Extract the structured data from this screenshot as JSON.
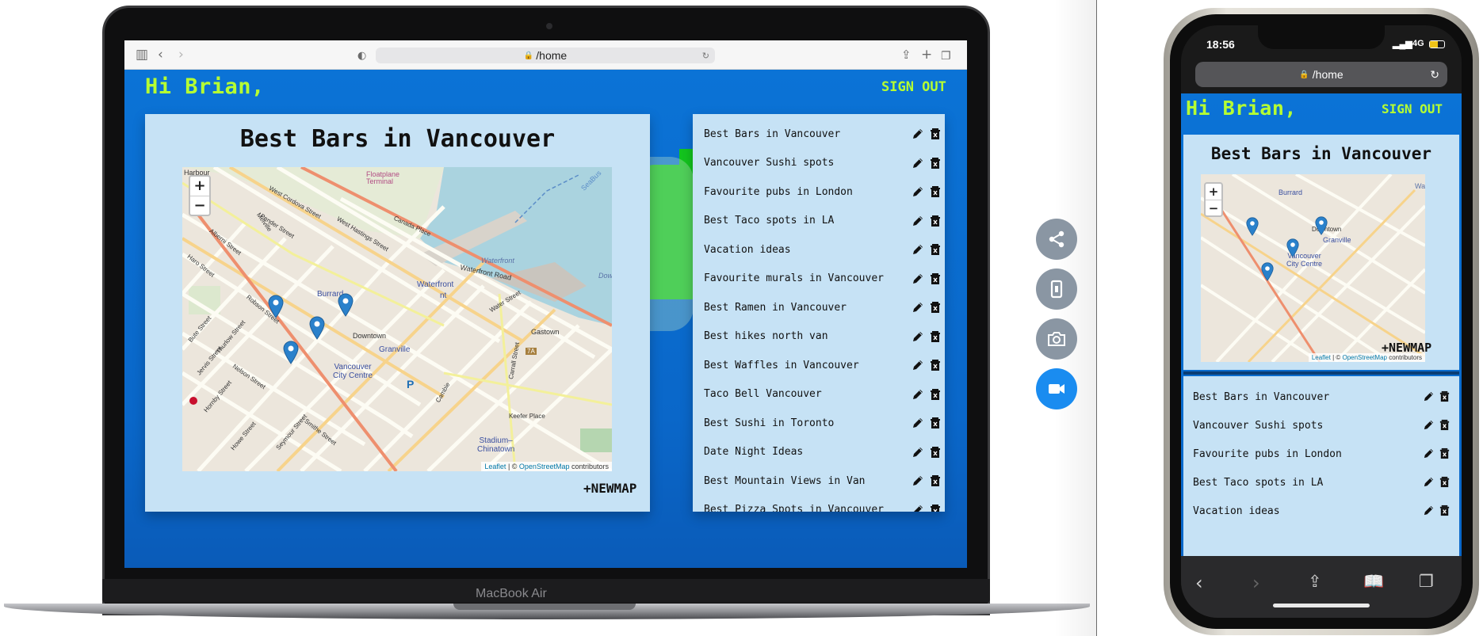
{
  "desktop": {
    "url": "/home",
    "greeting": "Hi Brian,",
    "sign_out": "SIGN OUT",
    "map_title": "Best Bars in Vancouver",
    "new_map": "+NEWMAP",
    "device_label": "MacBook Air",
    "attribution": {
      "leaflet": "Leaflet",
      "sep": " | © ",
      "osm": "OpenStreetMap",
      "contrib": " contributors"
    },
    "lists": [
      "Best Bars in Vancouver",
      "Vancouver Sushi spots",
      "Favourite pubs in London",
      "Best Taco spots in LA",
      "Vacation ideas",
      "Favourite murals in Vancouver",
      "Best Ramen in Vancouver",
      "Best hikes north van",
      "Best Waffles in Vancouver",
      "Taco Bell Vancouver",
      "Best Sushi in Toronto",
      "Date Night Ideas",
      "Best Mountain Views in Van",
      "Best Pizza Spots in Vancouver"
    ]
  },
  "map_labels": {
    "harbour": "Harbour",
    "floatplane": "Floatplane Terminal",
    "seabus": "SeaBus",
    "waterfront_a": "Waterfront",
    "waterfront_b": "Waterfront",
    "waterfront_road": "Waterfront Road",
    "waterfront_nt": "nt",
    "burrard": "Burrard",
    "downtown": "Downtown",
    "granville": "Granville",
    "vcc_line1": "Vancouver",
    "vcc_line2": "City Centre",
    "gastown": "Gastown",
    "stadium_line1": "Stadium–",
    "stadium_line2": "Chinatown",
    "pender": "Pender Street",
    "cordova": "West Cordova Street",
    "canada_place": "Canada Place",
    "hastings": "West Hastings Street",
    "robson": "Robson Street",
    "water_street": "Water Street",
    "seymour": "Seymour Street",
    "howe": "Howe Street",
    "hornby": "Hornby Street",
    "nelson": "Nelson Street",
    "smithe": "Smithe Street",
    "carrall": "Carrall Street",
    "keefer": "Keefer Place",
    "alberni": "Alberni Street",
    "haro": "Haro Street",
    "melville": "Melville",
    "thurlow": "Thurlow Street",
    "jervis": "Jervis Street",
    "bute": "Bute Street",
    "cambie": "Cambie",
    "seven_a": "7A",
    "dow": "Dow",
    "p": "P"
  },
  "phone": {
    "time": "18:56",
    "network": "4G",
    "url": "/home",
    "greeting": "Hi Brian,",
    "sign_out": "SIGN OUT",
    "map_title": "Best Bars in Vancouver",
    "new_map": "+NEWMAP",
    "lists": [
      "Best Bars in Vancouver",
      "Vancouver Sushi spots",
      "Favourite pubs in London",
      "Best Taco spots in LA",
      "Vacation ideas"
    ]
  },
  "side_actions": [
    {
      "name": "share",
      "icon": "share-icon"
    },
    {
      "name": "device",
      "icon": "phone-icon"
    },
    {
      "name": "screenshot",
      "icon": "camera-icon"
    },
    {
      "name": "record",
      "icon": "video-camera-icon"
    }
  ],
  "colors": {
    "app_blue": "#0a6fd1",
    "accent_green": "#b6ff32",
    "card_bg": "#c6e2f5",
    "pin_blue": "#2a81cb",
    "record_active": "#1a8cf0"
  }
}
